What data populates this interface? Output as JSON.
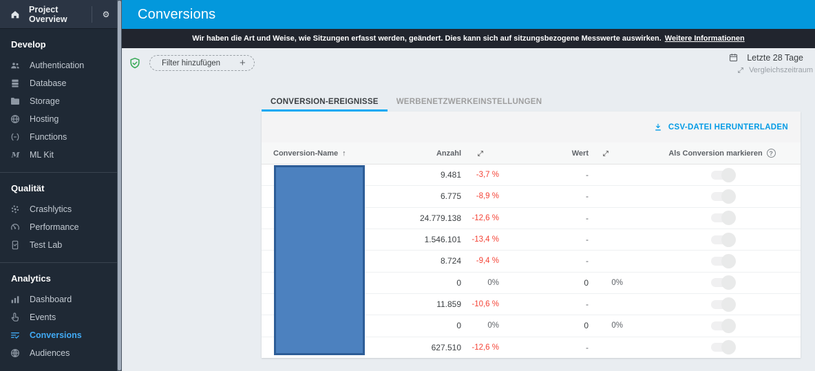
{
  "colors": {
    "header_blue": "#0398dc",
    "link_blue": "#039be5",
    "active_item_blue": "#41aaf5",
    "negative_red": "#f44336",
    "green_check": "#34a853",
    "redaction_fill": "#4c81bf",
    "redaction_border": "#2d5d97"
  },
  "sidebar": {
    "top": {
      "title": "Project Overview",
      "home_icon": "home-icon",
      "settings_icon": "gear-icon"
    },
    "sections": [
      {
        "label": "Develop",
        "items": [
          {
            "label": "Authentication",
            "icon": "people-icon"
          },
          {
            "label": "Database",
            "icon": "database-icon"
          },
          {
            "label": "Storage",
            "icon": "folder-icon"
          },
          {
            "label": "Hosting",
            "icon": "globe-icon"
          },
          {
            "label": "Functions",
            "icon": "functions-icon"
          },
          {
            "label": "ML Kit",
            "icon": "mlkit-icon"
          }
        ]
      },
      {
        "label": "Qualität",
        "items": [
          {
            "label": "Crashlytics",
            "icon": "crashlytics-icon"
          },
          {
            "label": "Performance",
            "icon": "speedometer-icon"
          },
          {
            "label": "Test Lab",
            "icon": "testlab-icon"
          }
        ]
      },
      {
        "label": "Analytics",
        "items": [
          {
            "label": "Dashboard",
            "icon": "barchart-icon"
          },
          {
            "label": "Events",
            "icon": "touch-icon"
          },
          {
            "label": "Conversions",
            "icon": "funnel-check-icon",
            "active": true
          },
          {
            "label": "Audiences",
            "icon": "audience-globe-icon"
          }
        ]
      }
    ]
  },
  "header": {
    "title": "Conversions"
  },
  "notification": {
    "text": "Wir haben die Art und Weise, wie Sitzungen erfasst werden, geändert. Dies kann sich auf sitzungsbezogene Messwerte auswirken.",
    "link": "Weitere Informationen"
  },
  "filter": {
    "button_label": "Filter hinzufügen",
    "plus": "+",
    "status_icon": "shield-check-icon"
  },
  "date_range": {
    "label": "Letzte 28 Tage",
    "compare_label": "Vergleichszeitraum",
    "calendar_icon": "calendar-icon",
    "compare_icon": "compare-arrows-icon"
  },
  "tabs": [
    {
      "label": "CONVERSION-EREIGNISSE",
      "active": true
    },
    {
      "label": "WERBENETZWERKEINSTELLUNGEN",
      "active": false
    }
  ],
  "download": {
    "label": "CSV-DATEI HERUNTERLADEN",
    "icon": "download-icon"
  },
  "table": {
    "columns": {
      "name": "Conversion-Name",
      "sort_indicator": "↑",
      "count": "Anzahl",
      "value": "Wert",
      "mark": "Als Conversion markieren",
      "help": "?"
    },
    "rows": [
      {
        "count": "9.481",
        "count_change": "-3,7 %",
        "value": "-",
        "value_change": "",
        "negative": true
      },
      {
        "count": "6.775",
        "count_change": "-8,9 %",
        "value": "-",
        "value_change": "",
        "negative": true
      },
      {
        "count": "24.779.138",
        "count_change": "-12,6 %",
        "value": "-",
        "value_change": "",
        "negative": true
      },
      {
        "count": "1.546.101",
        "count_change": "-13,4 %",
        "value": "-",
        "value_change": "",
        "negative": true
      },
      {
        "count": "8.724",
        "count_change": "-9,4 %",
        "value": "-",
        "value_change": "",
        "negative": true
      },
      {
        "count": "0",
        "count_change": "0%",
        "value": "0",
        "value_change": "0%",
        "negative": false
      },
      {
        "count": "11.859",
        "count_change": "-10,6 %",
        "value": "-",
        "value_change": "",
        "negative": true
      },
      {
        "count": "0",
        "count_change": "0%",
        "value": "0",
        "value_change": "0%",
        "negative": false
      },
      {
        "count": "627.510",
        "count_change": "-12,6 %",
        "value": "-",
        "value_change": "",
        "negative": true
      }
    ]
  }
}
